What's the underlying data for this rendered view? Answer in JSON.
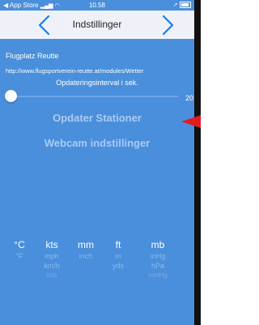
{
  "status_bar": {
    "back_app": "◀ App Store",
    "signal": "📶",
    "time": "10.58",
    "battery_icon": "battery-icon"
  },
  "navbar": {
    "title": "Indstillinger",
    "left_icon": "chevron-left-icon",
    "right_icon": "chevron-right-icon"
  },
  "station": {
    "name": "Flugplatz Reutte",
    "url": "http://www.flugsportverein-reutte.at/modules/Wetter"
  },
  "interval": {
    "label": "Opdateringsinterval i sek.",
    "value": "20",
    "slider_fraction": 0.0
  },
  "buttons": {
    "update_stations": "Opdater Stationer",
    "webcam_settings": "Webcam indstillinger"
  },
  "units": {
    "temperature": {
      "selected": "°C",
      "options": [
        "°F"
      ]
    },
    "speed": {
      "selected": "kts",
      "options": [
        "mph",
        "km/h",
        "m/s"
      ]
    },
    "rain": {
      "selected": "mm",
      "options": [
        "inch"
      ]
    },
    "altitude": {
      "selected": "ft",
      "options": [
        "m",
        "yds"
      ]
    },
    "pressure": {
      "selected": "mb",
      "options": [
        "inHg",
        "hPa",
        "mmHg"
      ]
    }
  },
  "colors": {
    "background": "#4a8fdb",
    "navbar": "#eef2f8",
    "accent": "#1a7cf0",
    "pointer": "#e01b24"
  }
}
